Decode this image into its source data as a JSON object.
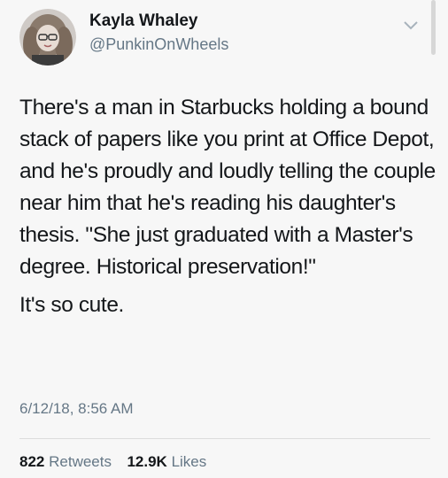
{
  "tweet": {
    "display_name": "Kayla Whaley",
    "handle": "@PunkinOnWheels",
    "paragraphs": [
      "There's a man in Starbucks holding a bound stack of papers like you print at Office Depot, and he's proudly and loudly telling the couple near him that he's reading his daughter's thesis. \"She just graduated with a Master's degree. Historical preservation!\"",
      "It's so cute."
    ],
    "timestamp": "6/12/18, 8:56 AM",
    "retweets_count": "822",
    "retweets_label": "Retweets",
    "likes_count": "12.9K",
    "likes_label": "Likes"
  },
  "icons": {
    "menu": "chevron-down-icon",
    "avatar": "avatar"
  }
}
